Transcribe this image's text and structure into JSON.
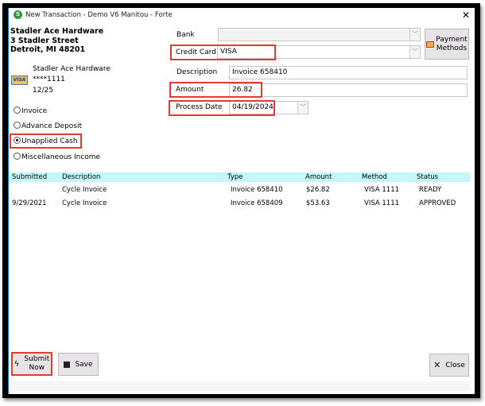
{
  "window": {
    "title": "New Transaction - Demo V6 Manitou - Forte",
    "app_icon": "S",
    "close": "✕"
  },
  "customer": {
    "name": "Stadler Ace Hardware",
    "street": "3 Stadler Street",
    "city": "Detroit, MI 48201"
  },
  "card": {
    "holder": "Stadler Ace Hardware",
    "number": "****1111",
    "expiry": "12/25",
    "brand": "VISA"
  },
  "types": [
    {
      "label": "Invoice",
      "selected": false
    },
    {
      "label": "Advance Deposit",
      "selected": false
    },
    {
      "label": "Unapplied Cash",
      "selected": true
    },
    {
      "label": "Miscellaneous Income",
      "selected": false
    }
  ],
  "form": {
    "bank_label": "Bank",
    "bank_value": "",
    "credit_card_label": "Credit Card",
    "credit_card_value": "VISA",
    "description_label": "Description",
    "description_value": "Invoice 658410",
    "amount_label": "Amount",
    "amount_value": "26.82",
    "process_date_label": "Process Date",
    "process_date_value": "04/19/2024",
    "payment_methods_line1": "Payment",
    "payment_methods_line2": "Methods"
  },
  "table": {
    "headers": [
      "Submitted",
      "Description",
      "Type",
      "Amount",
      "Method",
      "Status"
    ],
    "rows": [
      [
        "",
        "Cycle Invoice",
        "Invoice 658410",
        "$26.82",
        "VISA 1111",
        "READY"
      ],
      [
        "9/29/2021",
        "Cycle Invoice",
        "Invoice 658409",
        "$53.63",
        "VISA 1111",
        "APPROVED"
      ]
    ]
  },
  "buttons": {
    "submit_line1": "Submit",
    "submit_line2": "Now",
    "save": "Save",
    "close": "Close"
  },
  "colors": {
    "highlight": "#e53935",
    "table_header": "#c4f8f8"
  }
}
